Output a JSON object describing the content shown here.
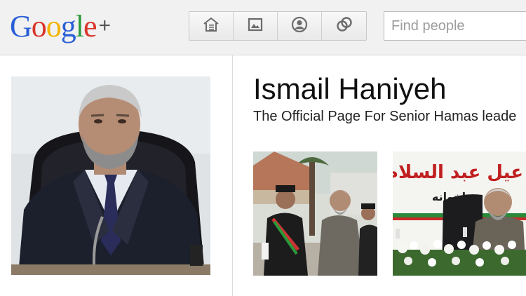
{
  "header": {
    "logo": {
      "letters": [
        {
          "char": "G",
          "color": "#2a5fd6"
        },
        {
          "char": "o",
          "color": "#d9352a"
        },
        {
          "char": "o",
          "color": "#f2b300"
        },
        {
          "char": "g",
          "color": "#2a5fd6"
        },
        {
          "char": "l",
          "color": "#2b9a3c"
        },
        {
          "char": "e",
          "color": "#d9352a"
        }
      ],
      "suffix": "+"
    },
    "nav": [
      {
        "name": "home",
        "icon": "home-icon"
      },
      {
        "name": "photos",
        "icon": "photos-icon"
      },
      {
        "name": "profile",
        "icon": "profile-icon"
      },
      {
        "name": "circles",
        "icon": "circles-icon"
      }
    ],
    "search": {
      "placeholder": "Find people",
      "value": ""
    }
  },
  "profile": {
    "name": "Ismail Haniyeh",
    "tagline": "The Official Page For Senior Hamas leade"
  },
  "photos": [
    {
      "name": "photo-thumbnail-1"
    },
    {
      "name": "photo-thumbnail-2",
      "banner_text": "عيل عبد السلام",
      "banner_subtext": "اخوانه"
    }
  ]
}
